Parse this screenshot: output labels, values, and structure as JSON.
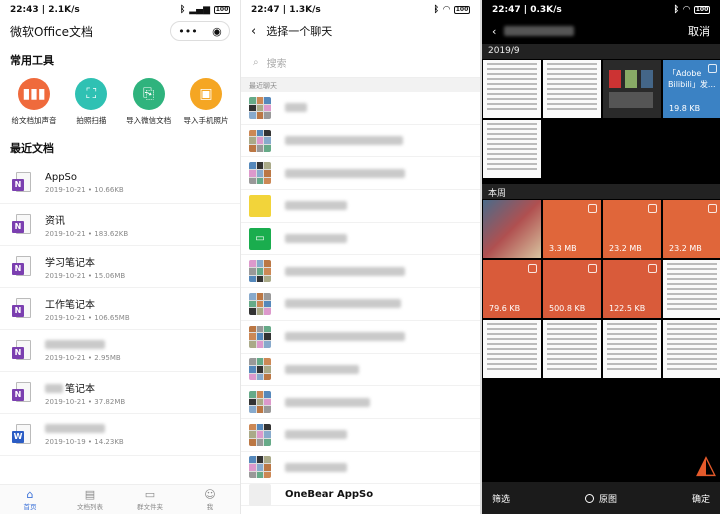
{
  "panel1": {
    "status": {
      "time": "22:43 | 2.1K/s",
      "battery": "100"
    },
    "title": "微软Office文档",
    "capsule_more": "•••",
    "capsule_close": "◉",
    "tools_heading": "常用工具",
    "tools": [
      {
        "label": "给文档加声音",
        "color": "#ef6a3c",
        "icon": "audio-wave-icon",
        "glyph": "▮▮▮"
      },
      {
        "label": "拍照扫描",
        "color": "#2fc1b3",
        "icon": "scan-icon",
        "glyph": "⛶"
      },
      {
        "label": "导入微信文档",
        "color": "#2fb37d",
        "icon": "import-doc-icon",
        "glyph": "⎘"
      },
      {
        "label": "导入手机照片",
        "color": "#f5a623",
        "icon": "photo-icon",
        "glyph": "▣"
      }
    ],
    "recent_heading": "最近文档",
    "docs": [
      {
        "name": "AppSo",
        "date": "2019-10-21",
        "size": "10.66KB",
        "type": "N",
        "color": "#7b3fb0"
      },
      {
        "name": "资讯",
        "date": "2019-10-21",
        "size": "183.62KB",
        "type": "N",
        "color": "#7b3fb0"
      },
      {
        "name": "学习笔记本",
        "date": "2019-10-21",
        "size": "15.06MB",
        "type": "N",
        "color": "#7b3fb0"
      },
      {
        "name": "工作笔记本",
        "date": "2019-10-21",
        "size": "106.65MB",
        "type": "N",
        "color": "#7b3fb0"
      },
      {
        "name": "",
        "date": "2019-10-21",
        "size": "2.95MB",
        "type": "N",
        "color": "#7b3fb0"
      },
      {
        "name": "笔记本",
        "date": "2019-10-21",
        "size": "37.82MB",
        "type": "N",
        "color": "#7b3fb0"
      },
      {
        "name": "",
        "date": "2019-10-19",
        "size": "14.23KB",
        "type": "W",
        "color": "#2b5cc4"
      }
    ],
    "date_sep": "•",
    "tabs": [
      {
        "label": "首页",
        "icon": "home-icon",
        "glyph": "⌂"
      },
      {
        "label": "文档列表",
        "icon": "doc-list-icon",
        "glyph": "▤"
      },
      {
        "label": "群文件夹",
        "icon": "group-folder-icon",
        "glyph": "▭"
      },
      {
        "label": "我",
        "icon": "person-icon",
        "glyph": "☺"
      }
    ]
  },
  "panel2": {
    "status": {
      "time": "22:47 | 1.3K/s",
      "battery": "100"
    },
    "title": "选择一个聊天",
    "search_placeholder": "搜索",
    "recent_label": "最近聊天",
    "last_chat_name": "OneBear AppSo"
  },
  "panel3": {
    "status": {
      "time": "22:47 | 0.3K/s",
      "battery": "100"
    },
    "cancel": "取消",
    "section1": "2019/9",
    "section2": "本周",
    "adobe_title": "「Adobe Bilibili」发...",
    "sizes": {
      "adobe": "19.8 KB",
      "s1": "3.3 MB",
      "s2": "23.2 MB",
      "s3": "23.2 MB",
      "s4": "79.6 KB",
      "s5": "500.8 KB",
      "s6": "122.5 KB"
    },
    "filter": "筛选",
    "original": "原图",
    "confirm": "确定",
    "colors": {
      "accent_orange": "#e0663a",
      "adobe_blue": "#3b82c4"
    }
  }
}
